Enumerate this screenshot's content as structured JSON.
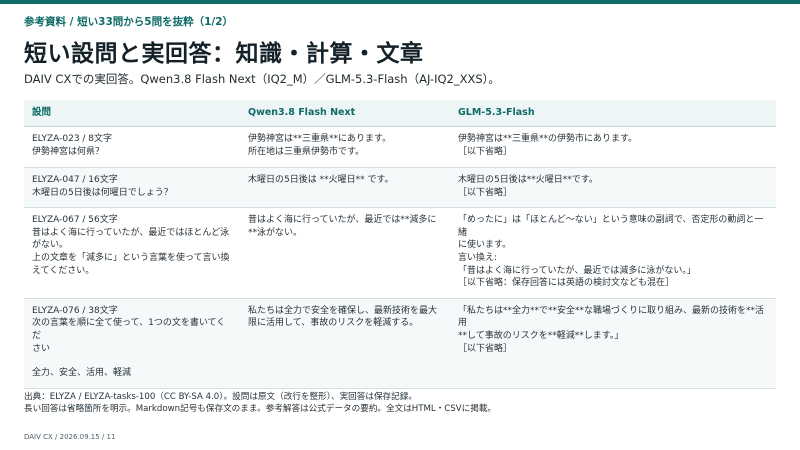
{
  "breadcrumb": "参考資料 / 短い33問から5問を抜粋（1/2）",
  "title": "短い設問と実回答：知識・計算・文章",
  "subtitle": "DAIV CXでの実回答。Qwen3.8 Flash Next（IQ2_M）／GLM-5.3-Flash（AJ-IQ2_XXS）。",
  "table": {
    "headers": [
      "設問",
      "Qwen3.8 Flash Next",
      "GLM-5.3-Flash"
    ],
    "rows": [
      {
        "question": [
          "ELYZA-023 / 8文字",
          "伊勢神宮は何県？"
        ],
        "qwen": [
          "伊勢神宮は**三重県**にあります。",
          "所在地は三重県伊勢市です。"
        ],
        "glm": [
          "伊勢神宮は**三重県**の伊勢市にあります。",
          "［以下省略］"
        ]
      },
      {
        "question": [
          "ELYZA-047 / 16文字",
          "木曜日の5日後は何曜日でしょう？"
        ],
        "qwen": [
          "木曜日の5日後は **火曜日** です。"
        ],
        "glm": [
          "木曜日の5日後は**火曜日**です。",
          "［以下省略］"
        ]
      },
      {
        "question": [
          "ELYZA-067 / 56文字",
          "昔はよく海に行っていたが、最近ではほとんど泳",
          "がない。",
          "上の文章を「減多に」という言葉を使って言い換",
          "えてください。"
        ],
        "qwen": [
          "昔はよく海に行っていたが、最近では**減多に",
          "**泳がない。"
        ],
        "glm": [
          "「めったに」は「ほとんど〜ない」という意味の副詞で、否定形の動詞と一緒",
          "に使います。",
          "言い換え:",
          "「昔はよく海に行っていたが、最近では減多に泳がない。」",
          "［以下省略：保存回答には英語の検討文なども混在］"
        ]
      },
      {
        "question": [
          "ELYZA-076 / 38文字",
          "次の言葉を順に全て使って、1つの文を書いてくだ",
          "さい",
          "",
          "全力、安全、活用、軽減"
        ],
        "qwen": [
          "私たちは全力で安全を確保し、最新技術を最大",
          "限に活用して、事故のリスクを軽減する。"
        ],
        "glm": [
          "「私たちは**全力**で**安全**な職場づくりに取り組み、最新の技術を**活用",
          "**して事故のリスクを**軽減**します。」",
          "［以下省略］"
        ]
      }
    ]
  },
  "footnote": [
    "出典：ELYZA / ELYZA-tasks-100（CC BY-SA 4.0）。設問は原文（改行を整形）、実回答は保存記録。",
    "長い回答は省略箇所を明示。Markdown記号も保存文のまま。参考解答は公式データの要約。全文はHTML・CSVに掲載。"
  ],
  "footer": "DAIV CX / 2026.09.15 / 11",
  "colors": {
    "accent": "#0e6b68",
    "header_bg": "#eef5f6",
    "row_alt_bg": "#f6f9fa"
  }
}
